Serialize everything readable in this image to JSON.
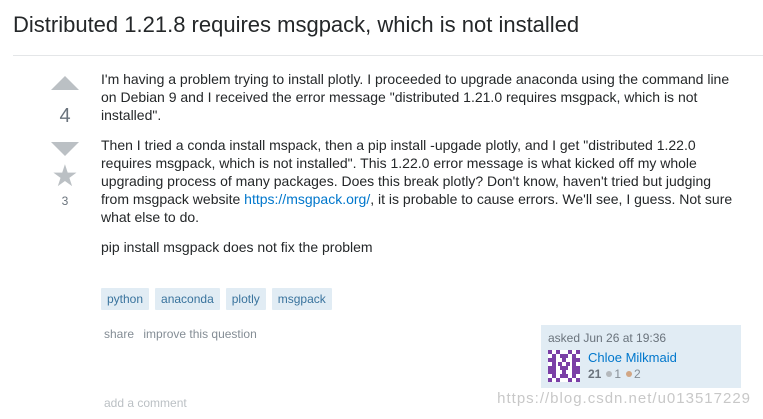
{
  "question": {
    "title": "Distributed 1.21.8 requires msgpack, which is not installed"
  },
  "votes": {
    "count": "4",
    "favorite_count": "3"
  },
  "body": {
    "paragraph1": "I'm having a problem trying to install plotly. I proceeded to upgrade anaconda using the command line on Debian 9 and I received the error message \"distributed 1.21.0 requires msgpack, which is not installed\".",
    "paragraph2_before_link": "Then I tried a conda install mspack, then a pip install -upgade plotly, and I get \"distributed 1.22.0 requires msgpack, which is not installed\". This 1.22.0 error message is what kicked off my whole upgrading process of many packages. Does this break plotly? Don't know, haven't tried but judging from msgpack website ",
    "paragraph2_link": "https://msgpack.org/",
    "paragraph2_after_link": ", it is probable to cause errors. We'll see, I guess. Not sure what else to do.",
    "paragraph3": "pip install msgpack does not fix the problem"
  },
  "tags": [
    "python",
    "anaconda",
    "plotly",
    "msgpack"
  ],
  "post_menu": {
    "share": "share",
    "improve": "improve this question"
  },
  "owner": {
    "asked": "asked Jun 26 at 19:36",
    "name": "Chloe Milkmaid",
    "reputation": "21",
    "silver_badges": "1",
    "bronze_badges": "2",
    "avatar_color": "#7b3fa6",
    "silver_color": "#b4b8bc",
    "bronze_color": "#d1a684"
  },
  "comments": {
    "add_label": "add a comment"
  },
  "watermark": "https://blog.csdn.net/u013517229"
}
